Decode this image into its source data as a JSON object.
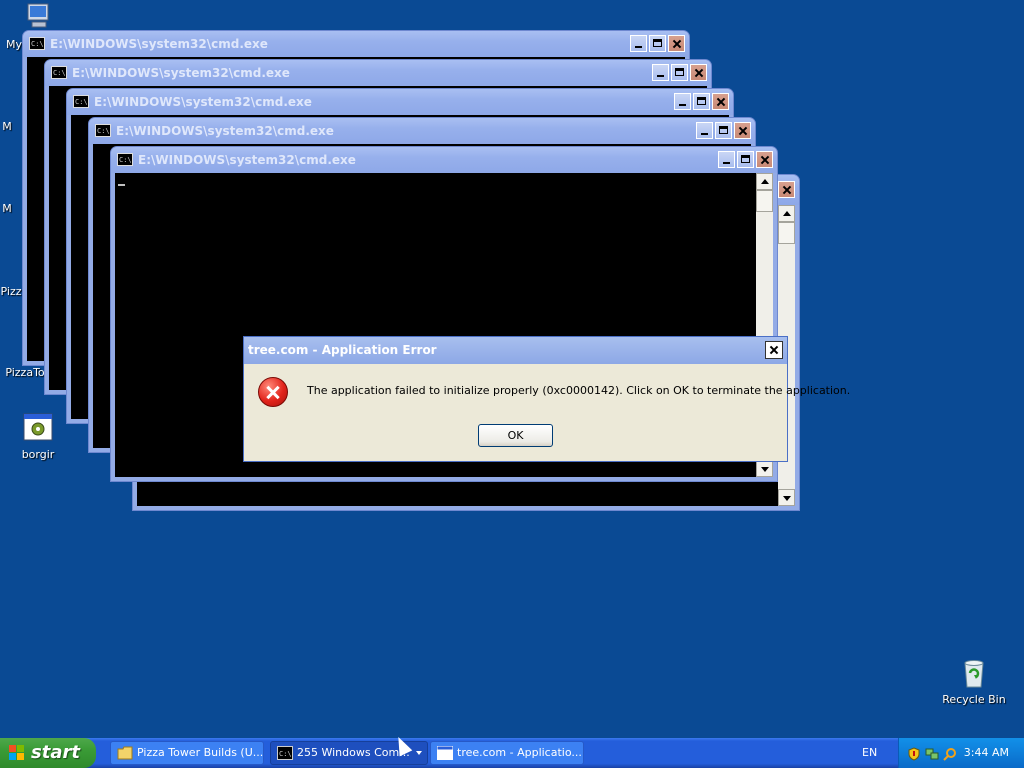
{
  "desktop": {
    "icons": [
      {
        "label": "My",
        "icon": "my-computer-icon"
      },
      {
        "label": "PizzaTo",
        "icon": "shortcut-icon"
      },
      {
        "label": "borgir",
        "icon": "application-icon"
      },
      {
        "label": "Recycle Bin",
        "icon": "recycle-bin-icon"
      }
    ],
    "partial_labels": [
      "M",
      "M",
      "Pizz"
    ]
  },
  "cmd_windows": [
    {
      "title": "E:\\WINDOWS\\system32\\cmd.exe"
    },
    {
      "title": "E:\\WINDOWS\\system32\\cmd.exe"
    },
    {
      "title": "E:\\WINDOWS\\system32\\cmd.exe"
    },
    {
      "title": "E:\\WINDOWS\\system32\\cmd.exe"
    },
    {
      "title": "E:\\WINDOWS\\system32\\cmd.exe"
    }
  ],
  "dialog": {
    "title": "tree.com - Application Error",
    "message": "The application failed to initialize properly (0xc0000142). Click on OK to terminate the application.",
    "ok_label": "OK",
    "icon": "error-icon"
  },
  "taskbar": {
    "start_label": "start",
    "tasks": [
      {
        "label": "Pizza Tower Builds (U...",
        "icon": "folder-icon",
        "active": false
      },
      {
        "label": "255 Windows Com...",
        "icon": "cmd-icon",
        "active": true
      },
      {
        "label": "tree.com - Applicatio...",
        "icon": "window-icon",
        "active": false
      }
    ],
    "language": "EN",
    "clock": "3:44 AM",
    "tray_icons": [
      "security-shield-icon",
      "network-icon",
      "search-icon"
    ]
  },
  "colors": {
    "desktop_bg": "#0a4a94",
    "taskbar": "#245edb",
    "start_button": "#3a9b36",
    "dialog_bg": "#ece9d8",
    "error_red": "#e2241b"
  }
}
